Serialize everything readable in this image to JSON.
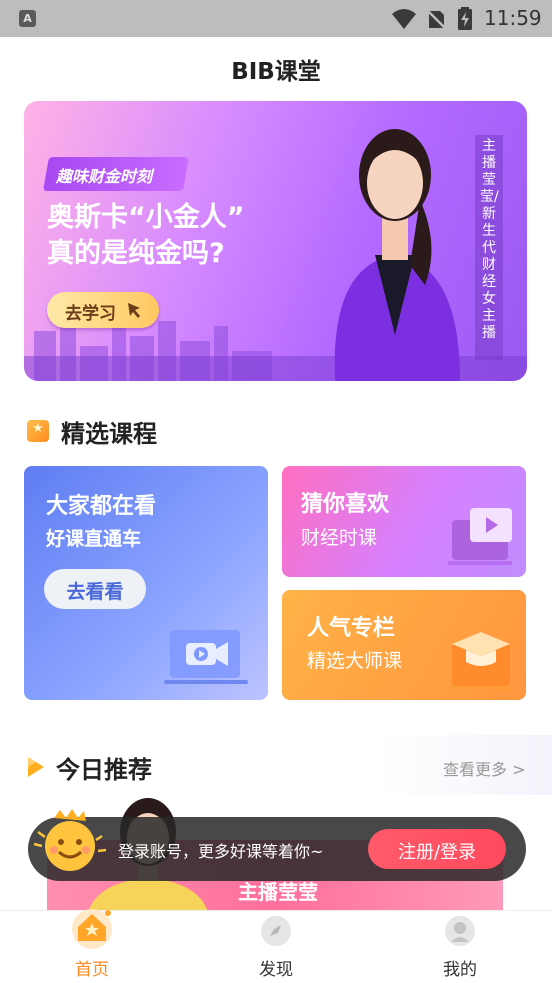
{
  "status_bar": {
    "app_icon": "A",
    "time": "11:59",
    "icons": [
      "wifi-icon",
      "no-sim-icon",
      "battery-charging-icon"
    ]
  },
  "header": {
    "title": "BIB课堂"
  },
  "banner": {
    "tag": "趣味财金时刻",
    "headline_line1": "奥斯卡“小金人”",
    "headline_line2": "真的是纯金吗?",
    "button_label": "去学习",
    "vertical_text": "主播莹莹/新生代财经女主播"
  },
  "featured": {
    "title": "精选课程",
    "cards": [
      {
        "title": "大家都在看",
        "subtitle": "好课直通车",
        "button": "去看看"
      },
      {
        "title": "猜你喜欢",
        "subtitle": "财经时课"
      },
      {
        "title": "人气专栏",
        "subtitle": "精选大师课"
      }
    ]
  },
  "recommend": {
    "title": "今日推荐",
    "more": "查看更多 >",
    "card_title": "主播莹莹"
  },
  "login_prompt": {
    "text": "登录账号，更多好课等着你~",
    "button": "注册/登录"
  },
  "bottom_nav": {
    "items": [
      {
        "label": "首页",
        "icon": "home-icon",
        "active": true
      },
      {
        "label": "发现",
        "icon": "compass-icon",
        "active": false
      },
      {
        "label": "我的",
        "icon": "profile-icon",
        "active": false
      }
    ]
  },
  "colors": {
    "accent": "#ff8a1f",
    "login_button": "#ff4a5e",
    "banner_purple": "#b36aff"
  }
}
